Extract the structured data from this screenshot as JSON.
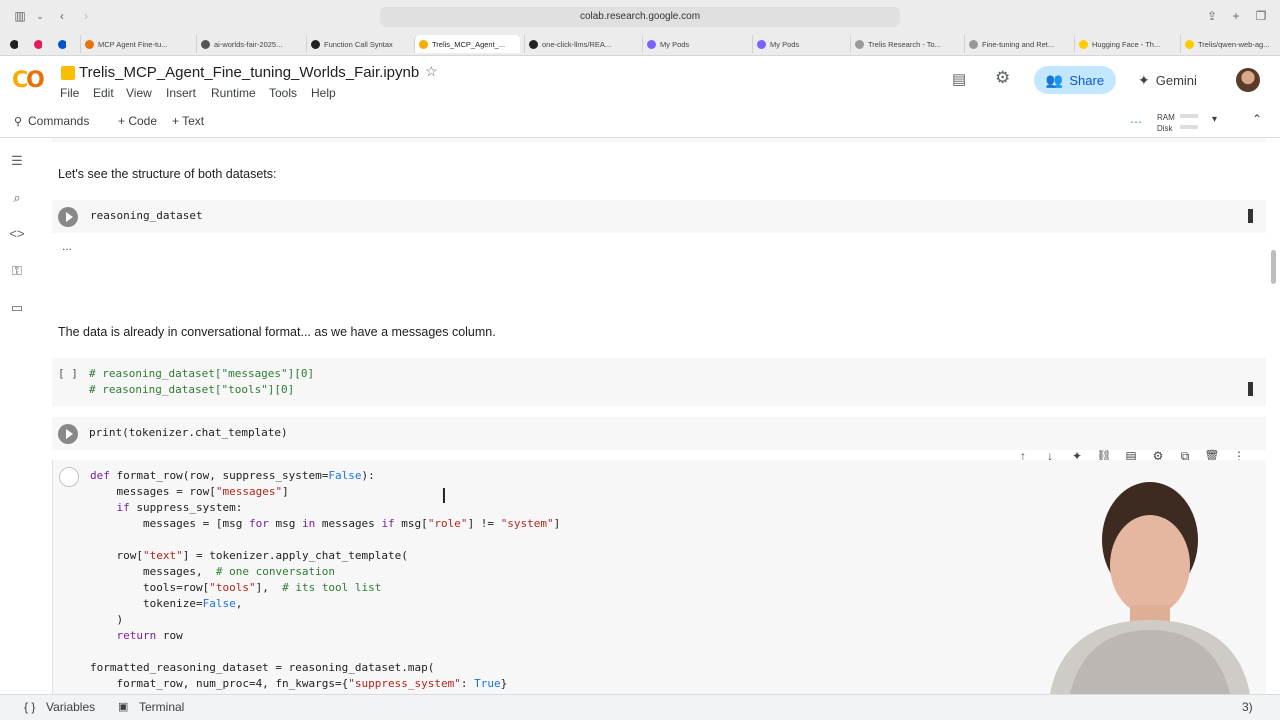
{
  "browser": {
    "url": "colab.research.google.com",
    "tabs": [
      {
        "label": "MCP Agent Fine-tu...",
        "color": "#e8710a"
      },
      {
        "label": "ai-worlds-fair-2025...",
        "color": "#555"
      },
      {
        "label": "Function Call Syntax",
        "color": "#222"
      },
      {
        "label": "Trelis_MCP_Agent_...",
        "color": "#f9ab00"
      },
      {
        "label": "one-click-llms/REA...",
        "color": "#222"
      },
      {
        "label": "My Pods",
        "color": "#7b61ff"
      },
      {
        "label": "My Pods",
        "color": "#7b61ff"
      },
      {
        "label": "Trelis Research - To...",
        "color": "#999"
      },
      {
        "label": "Fine-tuning and Ret...",
        "color": "#999"
      },
      {
        "label": "Hugging Face - Th...",
        "color": "#ffcc00"
      },
      {
        "label": "Trelis/qwen-web-ag...",
        "color": "#ffcc00"
      }
    ]
  },
  "colab": {
    "notebook_title": "Trelis_MCP_Agent_Fine_tuning_Worlds_Fair.ipynb",
    "menu": [
      "File",
      "Edit",
      "View",
      "Insert",
      "Runtime",
      "Tools",
      "Help"
    ],
    "share_label": "Share",
    "gemini_label": "Gemini",
    "commands_label": "Commands",
    "add_code_label": "+ Code",
    "add_text_label": "+ Text",
    "ram_label": "RAM",
    "disk_label": "Disk"
  },
  "cells": {
    "text1": "Let's see the structure of both datasets:",
    "code1": "reasoning_dataset",
    "output1": "...",
    "text2": "The data is already in conversational format... as we have a messages column.",
    "code2_prompt": "[ ]",
    "code2_line1": "# reasoning_dataset[\"messages\"][0]",
    "code2_line2": "# reasoning_dataset[\"tools\"][0]",
    "code3": "print(tokenizer.chat_template)"
  },
  "bottom_bar": {
    "variables_label": "Variables",
    "terminal_label": "Terminal",
    "status_count": "3)"
  }
}
